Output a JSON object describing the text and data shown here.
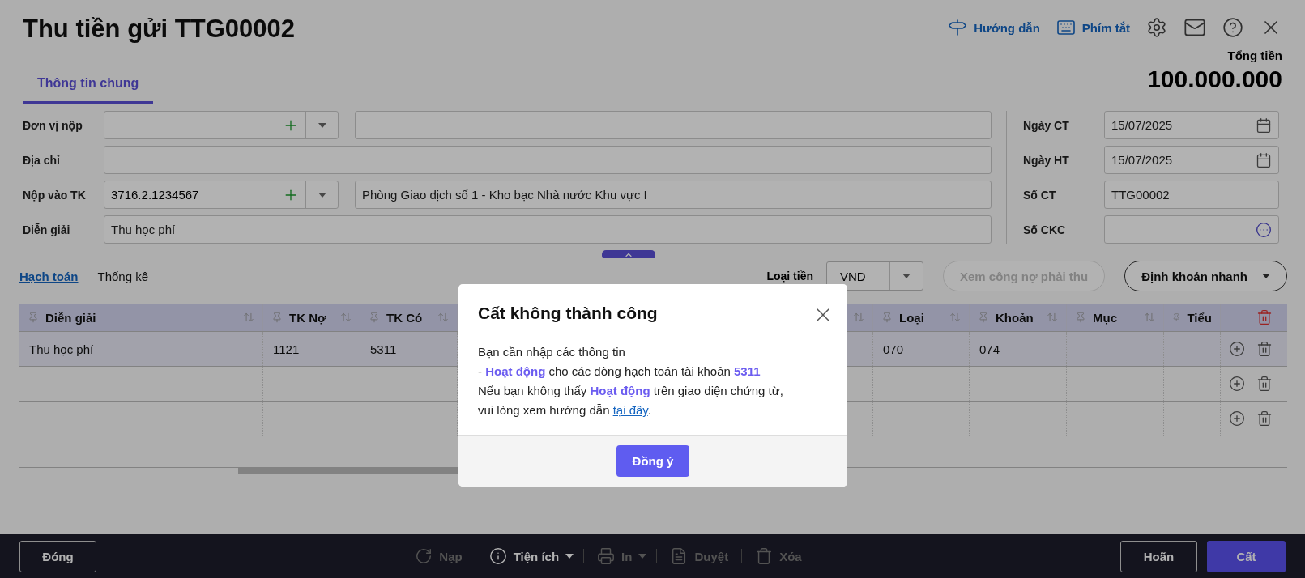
{
  "window": {
    "title": "Thu tiền gửi TTG00002"
  },
  "header_actions": [
    {
      "kind": "guide",
      "label": "Hướng dẫn"
    },
    {
      "kind": "shortcuts",
      "label": "Phím tắt"
    }
  ],
  "total": {
    "label": "Tổng tiền",
    "value": "100.000.000"
  },
  "tabs": [
    {
      "label": "Thông tin chung",
      "selected": true
    }
  ],
  "form": {
    "left": [
      {
        "label": "Đơn vị nộp",
        "kind": "combo"
      },
      {
        "label": "Địa chỉ",
        "kind": "text"
      },
      {
        "label": "Nộp vào TK",
        "kind": "combo",
        "value": "3716.2.1234567",
        "detail": "Phòng Giao dịch số 1 - Kho bạc Nhà nước Khu vực I"
      },
      {
        "label": "Diễn giải",
        "kind": "text",
        "value": "Thu học phí"
      }
    ],
    "right": [
      {
        "label": "Ngày CT",
        "kind": "date",
        "value": "15/07/2025"
      },
      {
        "label": "Ngày HT",
        "kind": "date",
        "value": "15/07/2025"
      },
      {
        "label": "Số CT",
        "kind": "text",
        "value": "TTG00002"
      },
      {
        "label": "Số CKC",
        "kind": "lookup"
      }
    ]
  },
  "subtabs": [
    {
      "label": "Hạch toán",
      "selected": true
    },
    {
      "label": "Thống kê",
      "selected": false
    }
  ],
  "currency": {
    "label": "Loại tiền",
    "value": "VND"
  },
  "toolbar_buttons": [
    {
      "label": "Xem công nợ phải thu",
      "disabled": true,
      "kind": "plain"
    },
    {
      "label": "Định khoản nhanh",
      "disabled": false,
      "kind": "menu"
    }
  ],
  "table": {
    "columns": [
      {
        "label": "Diễn giải"
      },
      {
        "label": "TK Nợ"
      },
      {
        "label": "TK Có"
      },
      {
        "label": "Loại"
      },
      {
        "label": "Khoản"
      },
      {
        "label": "Mục"
      },
      {
        "label": "Tiểu"
      }
    ],
    "rows": [
      {
        "cells": [
          "Thu học phí",
          "1121",
          "5311",
          "070",
          "074",
          "",
          ""
        ]
      },
      {
        "cells": [
          "",
          "",
          "",
          "",
          "",
          "",
          ""
        ]
      },
      {
        "cells": [
          "",
          "",
          "",
          "",
          "",
          "",
          ""
        ]
      }
    ]
  },
  "dialog": {
    "title": "Cất không thành công",
    "lines": [
      "Bạn cần nhập các thông tin",
      "- **Hoạt động** cho các dòng hạch toán tài khoản **5311**",
      "Nếu bạn không thấy **Hoạt động** trên giao diện chứng từ,"
    ],
    "last_line": {
      "text": "vui lòng xem hướng dẫn",
      "link": "tại đây",
      "after": "."
    },
    "button": "Đồng ý"
  },
  "footer": {
    "close": "Đóng",
    "actions": [
      {
        "kind": "reload",
        "label": "Nạp",
        "disabled": true,
        "menu": false
      },
      {
        "kind": "utilities",
        "label": "Tiện ích",
        "disabled": false,
        "menu": true
      },
      {
        "kind": "print",
        "label": "In",
        "disabled": true,
        "menu": true
      },
      {
        "kind": "approve",
        "label": "Duyệt",
        "disabled": true,
        "menu": false
      },
      {
        "kind": "delete",
        "label": "Xóa",
        "disabled": true,
        "menu": false
      }
    ],
    "defer": "Hoãn",
    "save": "Cất"
  }
}
